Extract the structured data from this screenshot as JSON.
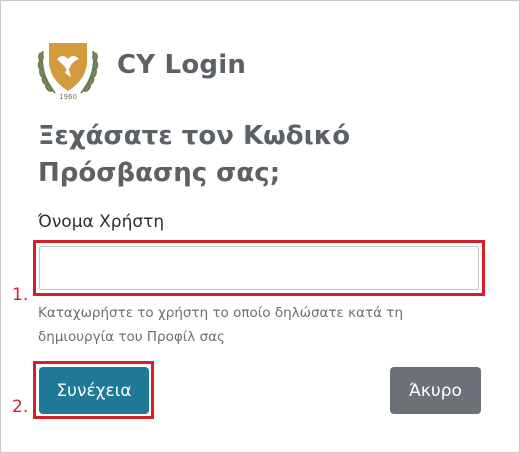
{
  "header": {
    "logo_icon": "cyprus-coat-of-arms-icon",
    "app_title": "CY Login"
  },
  "form": {
    "title": "Ξεχάσατε τον Κωδικό Πρόσβασης σας;",
    "username_label": "Όνομα Χρήστη",
    "username_value": "",
    "help_text": "Καταχωρήστε το χρήστη το οποίο δηλώσατε κατά τη δημιουργία του Προφίλ σας",
    "continue_label": "Συνέχεια",
    "cancel_label": "Άκυρο"
  },
  "annotations": {
    "step_1": "1.",
    "step_2": "2."
  },
  "colors": {
    "primary_button": "#1e7a96",
    "secondary_button": "#6c7177",
    "highlight": "#d71f2a",
    "heading_text": "#5c6166",
    "logo_gold": "#d49a3e",
    "logo_olive": "#6b7a53"
  }
}
